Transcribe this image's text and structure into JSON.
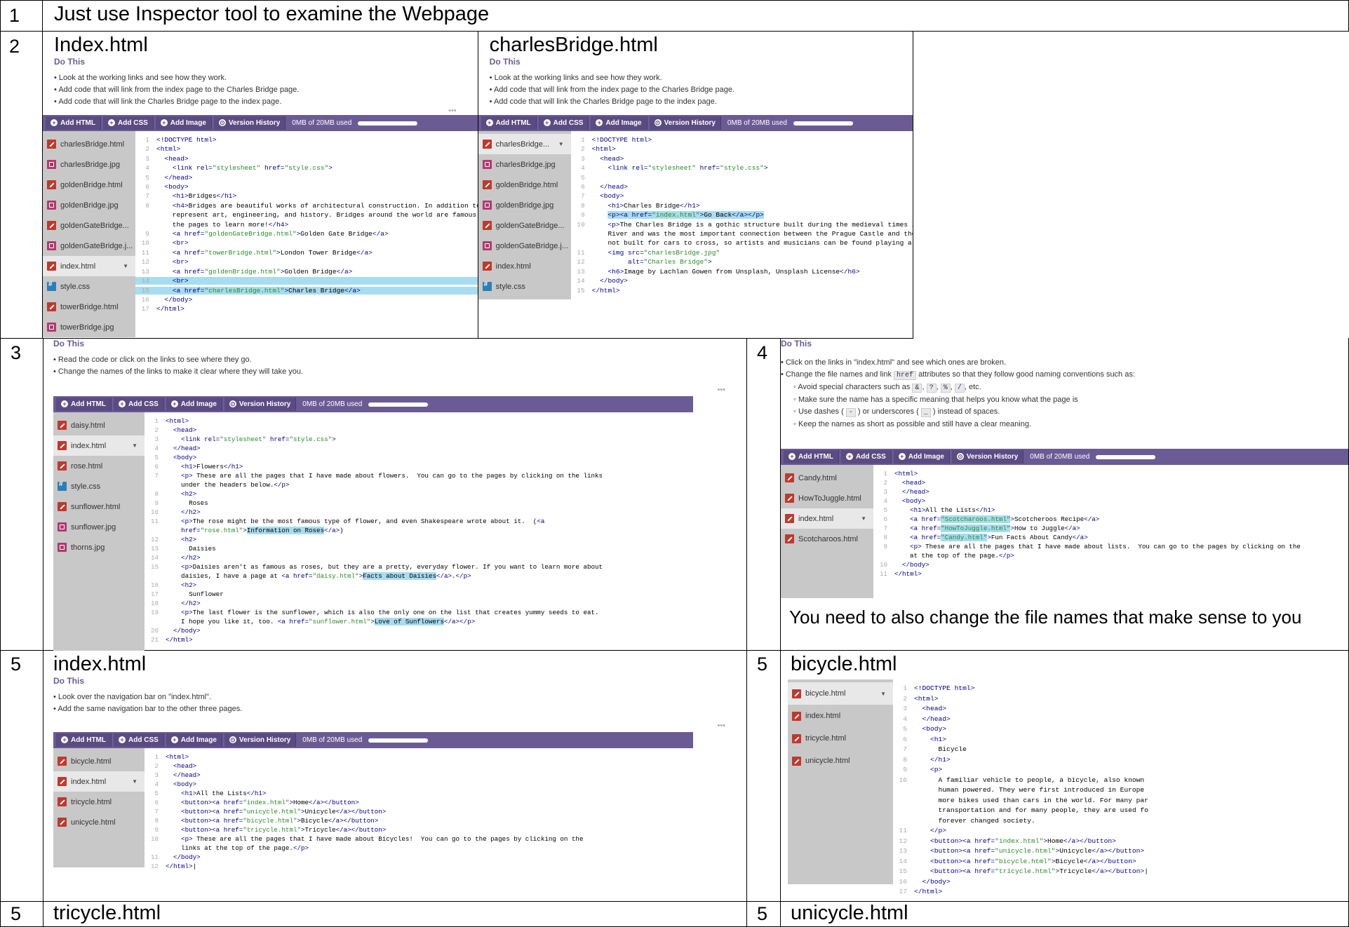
{
  "rows": {
    "r1": {
      "num": "1",
      "text": "Just use Inspector tool to examine the Webpage"
    },
    "r2": {
      "num": "2",
      "left_title": "Index.html",
      "right_title": "charlesBridge.html"
    },
    "r3": {
      "num": "3"
    },
    "r4": {
      "num": "4",
      "caption": "You need to also change the file names that make sense to you"
    },
    "r5": {
      "num_a": "5",
      "num_b": "5",
      "num_c": "5",
      "num_d": "5",
      "left_title": "index.html",
      "right_title": "bicycle.html",
      "bottom_left_title": "tricycle.html",
      "bottom_right_title": "unicycle.html"
    }
  },
  "toolbar": {
    "add_html": "Add HTML",
    "add_css": "Add CSS",
    "add_image": "Add Image",
    "version_history": "Version History",
    "storage": "0MB of 20MB used"
  },
  "do_this": "Do This",
  "panel2": {
    "bullets": [
      "Look at the working links and see how they work.",
      "Add code that will link from the index page to the Charles Bridge page.",
      "Add code that will link the Charles Bridge page to the index page."
    ],
    "files_left": [
      "charlesBridge.html",
      "charlesBridge.jpg",
      "goldenBridge.html",
      "goldenBridge.jpg",
      "goldenGateBridge...",
      "goldenGateBridge.j...",
      "index.html",
      "style.css",
      "towerBridge.html",
      "towerBridge.jpg"
    ],
    "files_right": [
      "charlesBridge...",
      "charlesBridge.jpg",
      "goldenBridge.html",
      "goldenBridge.jpg",
      "goldenGateBridge...",
      "goldenGateBridge.j...",
      "index.html",
      "style.css"
    ]
  },
  "panel3": {
    "bullets": [
      "Read the code or click on the links to see where they go.",
      "Change the names of the links to make it clear where they will take you."
    ],
    "files": [
      "daisy.html",
      "index.html",
      "rose.html",
      "style.css",
      "sunflower.html",
      "sunflower.jpg",
      "thorns.jpg"
    ]
  },
  "panel4": {
    "b1": "Click on the links in \"index.html\" and see which ones are broken.",
    "b2a": "Change the file names and link",
    "b2code": "href",
    "b2b": "attributes so that they follow good naming conventions such as:",
    "s1a": "Avoid special characters such as",
    "s1codes": [
      "&",
      "?",
      "%",
      "/"
    ],
    "s1b": ", etc.",
    "s2": "Make sure the name has a specific meaning that helps you know what the page is",
    "s3a": "Use dashes (",
    "s3c1": "-",
    "s3b": ") or underscores (",
    "s3c2": "_",
    "s3c": ") instead of spaces.",
    "s4": "Keep the names as short as possible and still have a clear meaning.",
    "files": [
      "Candy.html",
      "HowToJuggle.html",
      "index.html",
      "Scotcharoos.html"
    ]
  },
  "panel5": {
    "bullets": [
      "Look over the navigation bar on \"index.html\".",
      "Add the same navigation bar to the other three pages."
    ],
    "files": [
      "bicycle.html",
      "index.html",
      "tricycle.html",
      "unicycle.html"
    ],
    "files_right": [
      "bicycle.html",
      "index.html",
      "tricycle.html",
      "unicycle.html"
    ]
  }
}
